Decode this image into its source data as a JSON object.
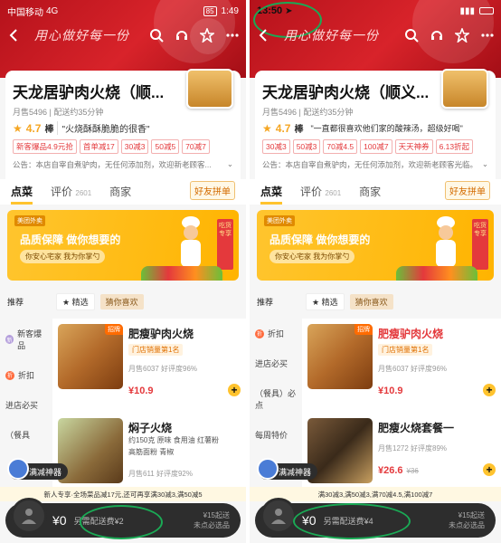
{
  "left": {
    "status": {
      "carrier": "中国移动",
      "net": "4G",
      "battery": "85",
      "time": "1:49"
    },
    "nav": {
      "slogan": "用心做好每一份"
    },
    "shop": {
      "name": "天龙居驴肉火烧（顺...",
      "sales": "月售5496",
      "delivery": "配送约35分钟",
      "score": "4.7",
      "bang": "棒",
      "quote": "\"火烧酥酥脆脆的很香\"",
      "tags": [
        "新客爆品4.9元抢",
        "首单减17",
        "30减3",
        "50减5",
        "70减7"
      ],
      "notice": "公告：本店自宰自煮驴肉，无任何添加剂，欢迎新老顾客..."
    },
    "tabs": {
      "order": "点菜",
      "review": "评价",
      "review_count": "2601",
      "merchant": "商家",
      "group": "好友拼单"
    },
    "ad": {
      "badge": "美团外卖",
      "title": "品质保障  做你想要的",
      "sub": "你安心宅家  我为你掌勺",
      "flag": "吃货专享"
    },
    "filter": {
      "label": "推荐",
      "chip1": "精选",
      "chip2": "猜你喜欢"
    },
    "side": [
      {
        "icon": "新",
        "label": "新客爆品"
      },
      {
        "icon": "折",
        "label": "折扣"
      },
      {
        "icon": "",
        "label": "进店必买"
      },
      {
        "icon": "",
        "label": "（餐具"
      }
    ],
    "dishes": [
      {
        "badge": "招牌",
        "name": "肥瘦驴肉火烧",
        "rank": "门店销量第1名",
        "stat": "月售6037  好评度96%",
        "price": "¥10.9",
        "orig": ""
      },
      {
        "badge": "",
        "name": "焖子火烧",
        "ingredients": "约150克  原味  食用油  红薯粉  高筋面粉  青椒",
        "stat": "月售611  好评度92%",
        "price": "",
        "orig": ""
      }
    ],
    "god": "满减神器",
    "promo": "新人专享·全场菜品减17元,还可再享满30减3,满50减5",
    "cart": {
      "amount": "¥0",
      "extra": "另需配送费¥2",
      "min": "¥15起送",
      "note": "未点必选品"
    }
  },
  "right": {
    "status": {
      "time": "13:50"
    },
    "nav": {
      "slogan": "用心做好每一份"
    },
    "shop": {
      "name": "天龙居驴肉火烧（顺义...",
      "sales": "月售5496",
      "delivery": "配送约35分钟",
      "score": "4.7",
      "bang": "棒",
      "quote": "\"一直都很喜欢他们家的酸辣汤，超级好喝\"",
      "tags": [
        "30减3",
        "50减3",
        "70减4.5",
        "100减7",
        "天天神券",
        "6.13折起"
      ],
      "notice": "公告：本店自宰自煮驴肉，无任何添加剂，欢迎新老顾客光临。"
    },
    "tabs": {
      "order": "点菜",
      "review": "评价",
      "review_count": "2601",
      "merchant": "商家",
      "group": "好友拼单"
    },
    "ad": {
      "badge": "美团外卖",
      "title": "品质保障  做你想要的",
      "sub": "你安心宅家  我为你掌勺",
      "flag": "吃货专享"
    },
    "filter": {
      "label": "推荐",
      "chip1": "精选",
      "chip2": "猜你喜欢"
    },
    "side": [
      {
        "icon": "折",
        "label": "折扣"
      },
      {
        "icon": "",
        "label": "进店必买"
      },
      {
        "icon": "",
        "label": "（餐具）必点"
      },
      {
        "icon": "",
        "label": "每周特价"
      }
    ],
    "dishes": [
      {
        "badge": "招牌",
        "name": "肥瘦驴肉火烧",
        "rank": "门店销量第1名",
        "stat": "月售6037  好评度96%",
        "price": "¥10.9",
        "orig": ""
      },
      {
        "badge": "",
        "name": "肥瘦火烧套餐一",
        "rank": "",
        "stat": "月售1272  好评度89%",
        "price": "¥26.6",
        "orig": "¥36"
      }
    ],
    "god": "满减神器",
    "promo": "满30减3,满50减3,满70减4.5,满100减7",
    "cart": {
      "amount": "¥0",
      "extra": "另需配送费¥4",
      "min": "¥15起送",
      "note": "未点必选品"
    }
  }
}
